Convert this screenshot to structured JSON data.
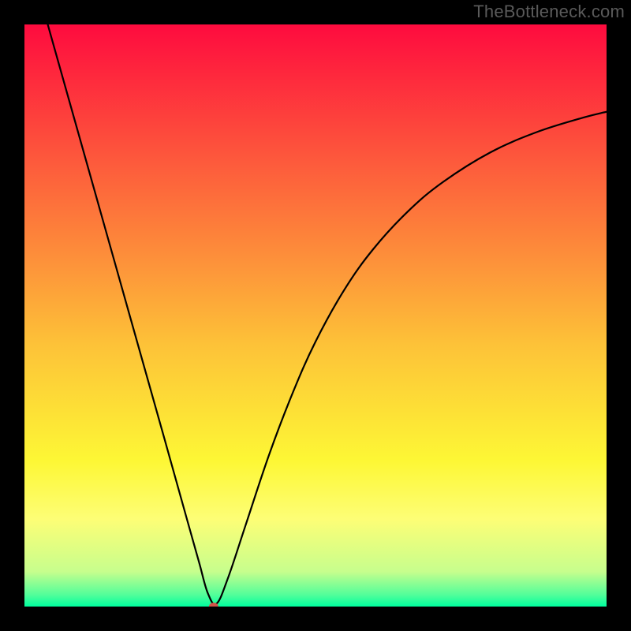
{
  "watermark": "TheBottleneck.com",
  "chart_data": {
    "type": "line",
    "title": "",
    "xlabel": "",
    "ylabel": "",
    "xlim": [
      0,
      100
    ],
    "ylim": [
      0,
      100
    ],
    "grid": false,
    "legend": false,
    "background_gradient": {
      "orientation": "vertical",
      "stops": [
        {
          "offset": 0.0,
          "color": "#fe0b3e"
        },
        {
          "offset": 0.2,
          "color": "#fd4e3c"
        },
        {
          "offset": 0.4,
          "color": "#fd8f3a"
        },
        {
          "offset": 0.55,
          "color": "#fdc238"
        },
        {
          "offset": 0.75,
          "color": "#fdf735"
        },
        {
          "offset": 0.85,
          "color": "#fdfe76"
        },
        {
          "offset": 0.94,
          "color": "#c7fe8d"
        },
        {
          "offset": 0.98,
          "color": "#52fe9a"
        },
        {
          "offset": 1.0,
          "color": "#00fe9e"
        }
      ]
    },
    "series": [
      {
        "name": "bottleneck-curve",
        "color": "#000000",
        "x": [
          4.0,
          8.0,
          12.0,
          16.0,
          20.0,
          24.0,
          28.0,
          30.0,
          31.5,
          33.0,
          35.0,
          38.0,
          42.0,
          46.0,
          50.0,
          55.0,
          60.0,
          66.0,
          72.0,
          80.0,
          88.0,
          96.0,
          100.0
        ],
        "y": [
          100.0,
          85.8,
          71.6,
          57.4,
          43.2,
          29.0,
          14.7,
          7.6,
          2.3,
          0.5,
          5.0,
          14.0,
          26.0,
          36.5,
          45.5,
          54.5,
          61.5,
          68.0,
          73.0,
          78.0,
          81.5,
          84.0,
          85.0
        ]
      }
    ],
    "markers": [
      {
        "name": "minimum-point",
        "x": 32.5,
        "y": 0.0,
        "color": "#d1544a",
        "rx": 6,
        "ry": 5
      }
    ],
    "plot_frame": {
      "color": "#000000",
      "thickness_px": 31
    }
  }
}
